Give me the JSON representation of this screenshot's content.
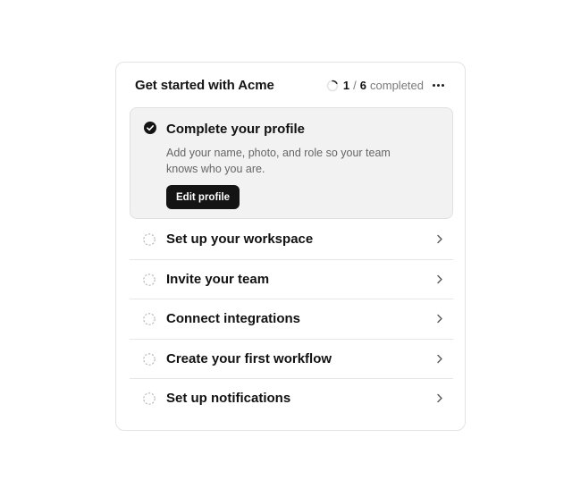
{
  "card": {
    "title": "Get started with Acme",
    "progress": {
      "completed": "1",
      "separator": "/",
      "total": "6",
      "word": "completed",
      "fraction": 0.1667
    }
  },
  "active_step": {
    "title": "Complete your profile",
    "description": "Add your name, photo, and role so your team knows who you are.",
    "button_label": "Edit profile",
    "status": "completed"
  },
  "steps": [
    {
      "label": "Set up your workspace",
      "status": "incomplete"
    },
    {
      "label": "Invite your team",
      "status": "incomplete"
    },
    {
      "label": "Connect integrations",
      "status": "incomplete"
    },
    {
      "label": "Create your first workflow",
      "status": "incomplete"
    },
    {
      "label": "Set up notifications",
      "status": "incomplete"
    }
  ],
  "icons": {
    "progress": "progress-ring-icon",
    "more": "more-horizontal-icon",
    "check": "check-circle-icon",
    "pending": "dashed-circle-icon",
    "chevron": "chevron-right-icon"
  },
  "colors": {
    "accent": "#141414",
    "active_bg": "#f2f2f2",
    "muted_text": "#666666",
    "border": "#e3e3e3"
  }
}
